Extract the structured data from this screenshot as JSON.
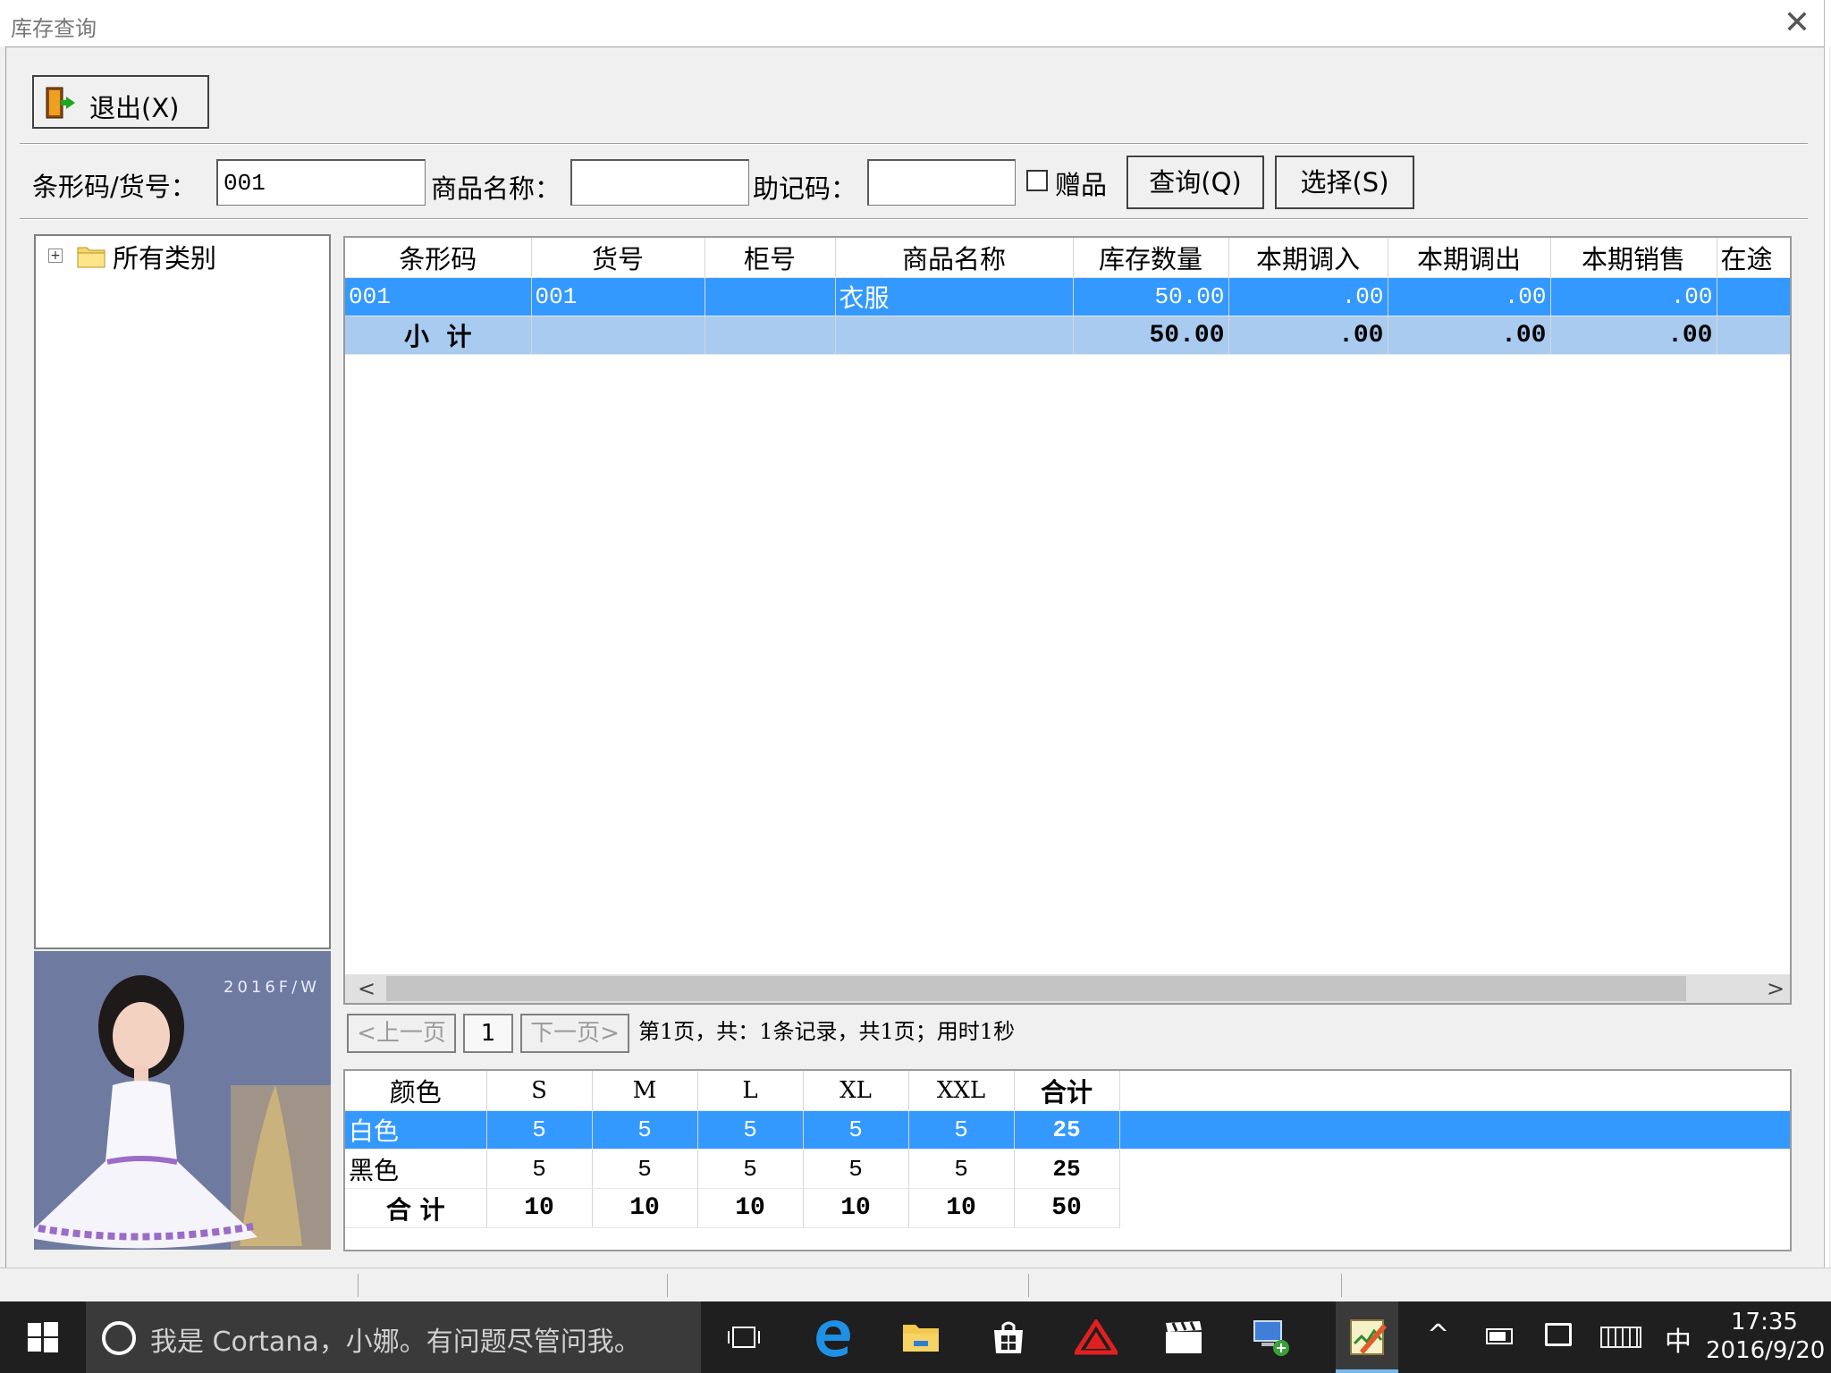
{
  "window": {
    "title": "库存查询",
    "close_glyph": "✕"
  },
  "toolbar": {
    "exit_label": "退出(X)"
  },
  "search": {
    "barcode_label": "条形码/货号：",
    "barcode_value": "001",
    "name_label": "商品名称：",
    "name_value": "",
    "mnemonic_label": "助记码：",
    "mnemonic_value": "",
    "gift_label": "赠品",
    "gift_checked": false,
    "query_label": "查询(Q)",
    "select_label": "选择(S)"
  },
  "tree": {
    "root_label": "所有类别",
    "expander": "⊞"
  },
  "product_image": {
    "caption": "2016F/W"
  },
  "grid": {
    "columns": [
      "条形码",
      "货号",
      "柜号",
      "商品名称",
      "库存数量",
      "本期调入",
      "本期调出",
      "本期销售",
      "在途"
    ],
    "rows": [
      [
        "001",
        "001",
        "",
        "衣服",
        "50.00",
        ".00",
        ".00",
        ".00",
        ""
      ]
    ],
    "subtotal": [
      "小  计",
      "",
      "",
      "",
      "50.00",
      ".00",
      ".00",
      ".00",
      ""
    ]
  },
  "pager": {
    "prev_label": "<上一页",
    "page": "1",
    "next_label": "下一页>",
    "status": "第1页，共：1条记录，共1页；用时1秒"
  },
  "size_grid": {
    "columns": [
      "颜色",
      "S",
      "M",
      "L",
      "XL",
      "XXL",
      "合计"
    ],
    "rows": [
      [
        "白色",
        "5",
        "5",
        "5",
        "5",
        "5",
        "25"
      ],
      [
        "黑色",
        "5",
        "5",
        "5",
        "5",
        "5",
        "25"
      ]
    ],
    "total": [
      "合 计",
      "10",
      "10",
      "10",
      "10",
      "10",
      "50"
    ]
  },
  "taskbar": {
    "search_text": "我是 Cortana，小娜。有问题尽管问我。",
    "ime": "中",
    "time": "17:35",
    "date": "2016/9/20"
  }
}
